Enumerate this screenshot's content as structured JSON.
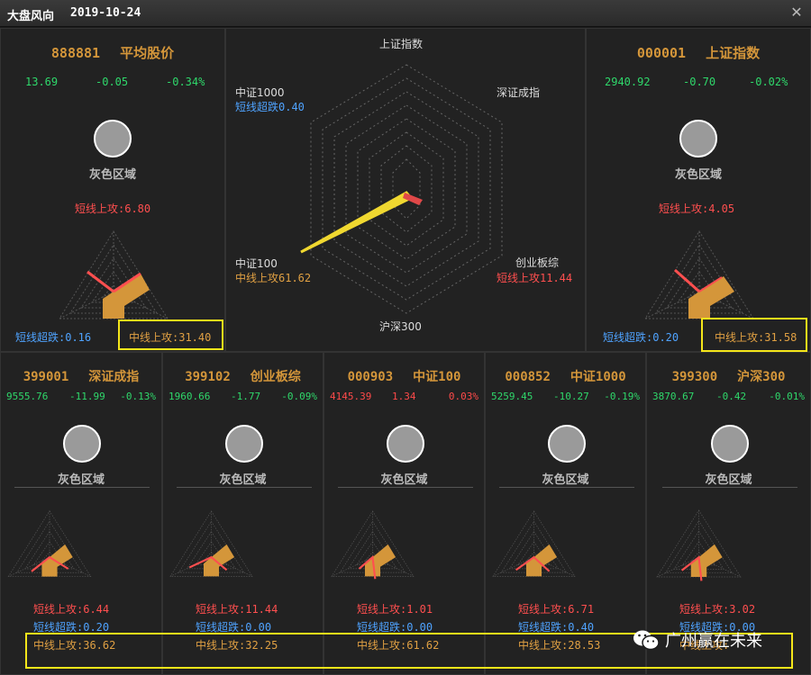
{
  "window": {
    "title": "大盘风向",
    "date": "2019-10-24",
    "close_label": "✕"
  },
  "top_left": {
    "code": "888881",
    "name": "平均股价",
    "price": "13.69",
    "change": "-0.05",
    "pct": "-0.34%",
    "zone": "灰色区域",
    "short_up": "短线上攻:6.80",
    "short_down": "短线超跌:0.16",
    "mid_up": "中线上攻:31.40"
  },
  "top_right": {
    "code": "000001",
    "name": "上证指数",
    "price": "2940.92",
    "change": "-0.70",
    "pct": "-0.02%",
    "zone": "灰色区域",
    "short_up": "短线上攻:4.05",
    "short_down": "短线超跌:0.20",
    "mid_up": "中线上攻:31.58"
  },
  "radar": {
    "axes": [
      "上证指数",
      "深证成指",
      "创业板综",
      "沪深300",
      "中证100",
      "中证1000"
    ],
    "values": [
      0,
      0,
      11.44,
      0,
      61.62,
      0.4
    ],
    "label_zz1000": "中证1000",
    "label_zz1000_val": "短线超跌0.40",
    "label_zz100": "中证100",
    "label_zz100_val": "中线上攻61.62",
    "label_cyb": "创业板综",
    "label_cyb_val": "短线上攻11.44"
  },
  "bottom": [
    {
      "code": "399001",
      "name": "深证成指",
      "price": "9555.76",
      "change": "-11.99",
      "pct": "-0.13%",
      "dir": "green",
      "zone": "灰色区域",
      "short_up": "短线上攻:6.44",
      "short_down": "短线超跌:0.20",
      "mid_up": "中线上攻:36.62"
    },
    {
      "code": "399102",
      "name": "创业板综",
      "price": "1960.66",
      "change": "-1.77",
      "pct": "-0.09%",
      "dir": "green",
      "zone": "灰色区域",
      "short_up": "短线上攻:11.44",
      "short_down": "短线超跌:0.00",
      "mid_up": "中线上攻:32.25"
    },
    {
      "code": "000903",
      "name": "中证100",
      "price": "4145.39",
      "change": "1.34",
      "pct": "0.03%",
      "dir": "red",
      "zone": "灰色区域",
      "short_up": "短线上攻:1.01",
      "short_down": "短线超跌:0.00",
      "mid_up": "中线上攻:61.62"
    },
    {
      "code": "000852",
      "name": "中证1000",
      "price": "5259.45",
      "change": "-10.27",
      "pct": "-0.19%",
      "dir": "green",
      "zone": "灰色区域",
      "short_up": "短线上攻:6.71",
      "short_down": "短线超跌:0.40",
      "mid_up": "中线上攻:28.53"
    },
    {
      "code": "399300",
      "name": "沪深300",
      "price": "3870.67",
      "change": "-0.42",
      "pct": "-0.01%",
      "dir": "green",
      "zone": "灰色区域",
      "short_up": "短线上攻:3.02",
      "short_down": "短线超跌:0.00",
      "mid_up": "中线上攻:"
    }
  ],
  "watermark": {
    "text": "广州赢在未来",
    "icon": "wechat-icon"
  },
  "colors": {
    "orange": "#d4963a",
    "red": "#ff4f4f",
    "blue": "#4fa3ff",
    "green": "#2fd86b",
    "highlight": "#f5e61a"
  }
}
